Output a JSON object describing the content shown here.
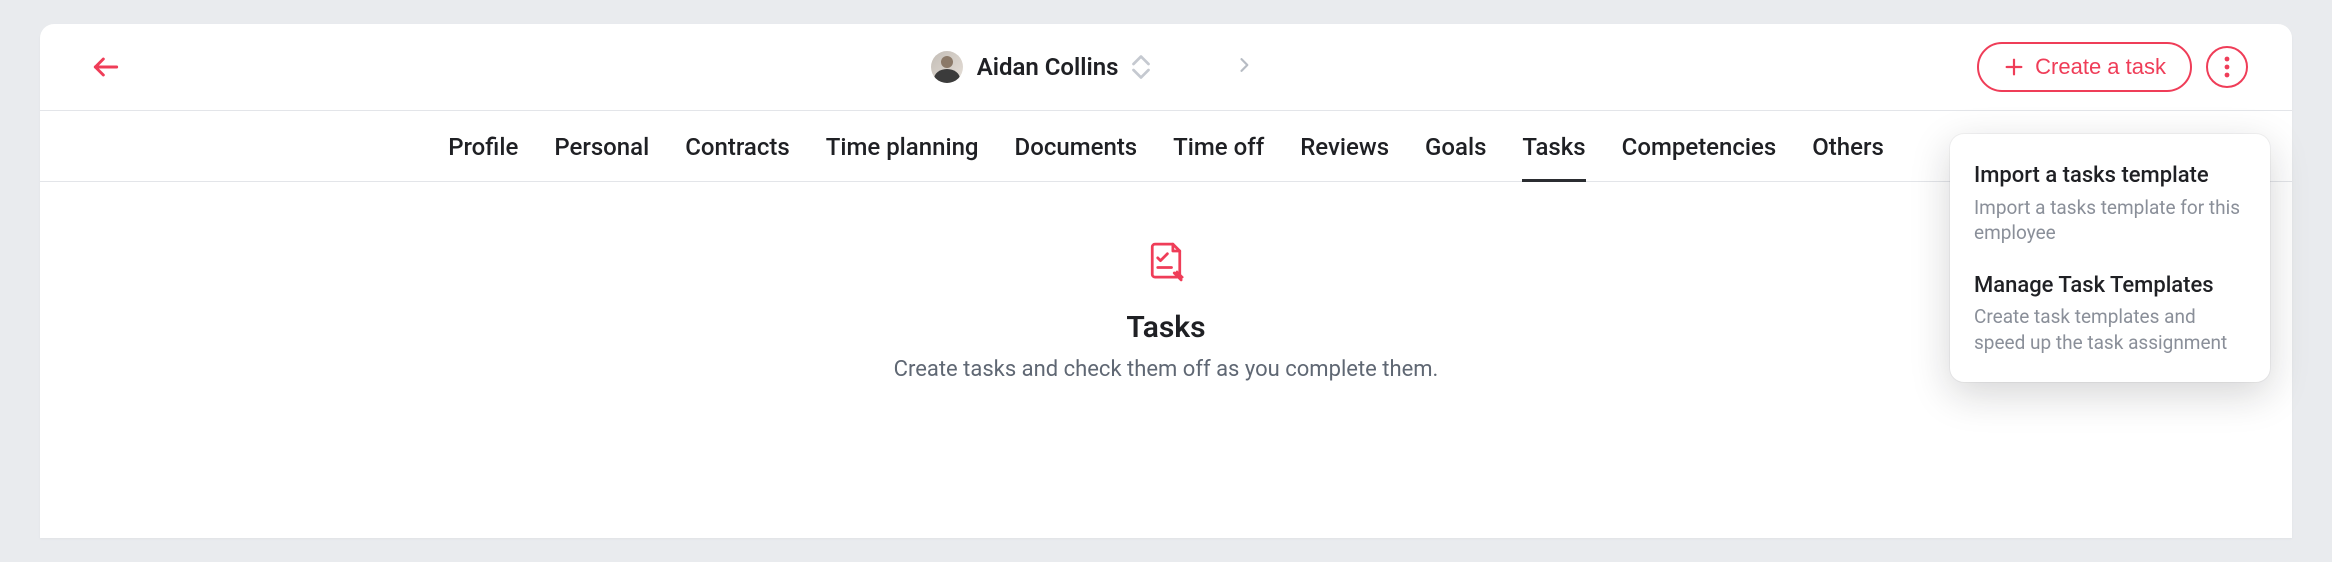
{
  "header": {
    "user_name": "Aidan Collins",
    "create_btn_label": "Create a task"
  },
  "tabs": [
    {
      "label": "Profile",
      "active": false
    },
    {
      "label": "Personal",
      "active": false
    },
    {
      "label": "Contracts",
      "active": false
    },
    {
      "label": "Time planning",
      "active": false
    },
    {
      "label": "Documents",
      "active": false
    },
    {
      "label": "Time off",
      "active": false
    },
    {
      "label": "Reviews",
      "active": false
    },
    {
      "label": "Goals",
      "active": false
    },
    {
      "label": "Tasks",
      "active": true
    },
    {
      "label": "Competencies",
      "active": false
    },
    {
      "label": "Others",
      "active": false
    }
  ],
  "empty_state": {
    "title": "Tasks",
    "subtitle": "Create tasks and check them off as you complete them."
  },
  "popover": [
    {
      "title": "Import a tasks template",
      "desc": "Import a tasks template for this employee"
    },
    {
      "title": "Manage Task Templates",
      "desc": "Create task templates and speed up the task assignment"
    }
  ]
}
